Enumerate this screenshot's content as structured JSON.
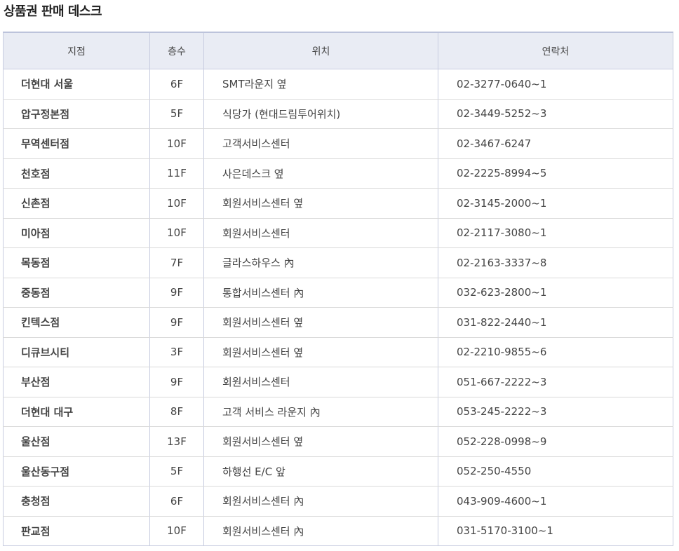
{
  "page_title": "상품권 판매 데스크",
  "table": {
    "headers": [
      "지점",
      "층수",
      "위치",
      "연락처"
    ],
    "rows": [
      {
        "branch": "더현대 서울",
        "floor": "6F",
        "location": "SMT라운지 옆",
        "tel": "02-3277-0640~1"
      },
      {
        "branch": "압구정본점",
        "floor": "5F",
        "location": "식당가 (현대드림투어위치)",
        "tel": "02-3449-5252~3"
      },
      {
        "branch": "무역센터점",
        "floor": "10F",
        "location": "고객서비스센터",
        "tel": "02-3467-6247"
      },
      {
        "branch": "천호점",
        "floor": "11F",
        "location": "사은데스크 옆",
        "tel": "02-2225-8994~5"
      },
      {
        "branch": "신촌점",
        "floor": "10F",
        "location": "회원서비스센터 옆",
        "tel": "02-3145-2000~1"
      },
      {
        "branch": "미아점",
        "floor": "10F",
        "location": "회원서비스센터",
        "tel": "02-2117-3080~1"
      },
      {
        "branch": "목동점",
        "floor": "7F",
        "location": "글라스하우스 內",
        "tel": "02-2163-3337~8"
      },
      {
        "branch": "중동점",
        "floor": "9F",
        "location": "통합서비스센터 內",
        "tel": "032-623-2800~1"
      },
      {
        "branch": "킨텍스점",
        "floor": "9F",
        "location": "회원서비스센터 옆",
        "tel": "031-822-2440~1"
      },
      {
        "branch": "디큐브시티",
        "floor": "3F",
        "location": "회원서비스센터 옆",
        "tel": "02-2210-9855~6"
      },
      {
        "branch": "부산점",
        "floor": "9F",
        "location": "회원서비스센터",
        "tel": "051-667-2222~3"
      },
      {
        "branch": "더현대 대구",
        "floor": "8F",
        "location": "고객 서비스 라운지 內",
        "tel": "053-245-2222~3"
      },
      {
        "branch": "울산점",
        "floor": "13F",
        "location": "회원서비스센터 옆",
        "tel": "052-228-0998~9"
      },
      {
        "branch": "울산동구점",
        "floor": "5F",
        "location": "하행선 E/C 앞",
        "tel": "052-250-4550"
      },
      {
        "branch": "충청점",
        "floor": "6F",
        "location": "회원서비스센터 內",
        "tel": "043-909-4600~1"
      },
      {
        "branch": "판교점",
        "floor": "10F",
        "location": "회원서비스센터 內",
        "tel": "031-5170-3100~1"
      }
    ]
  }
}
